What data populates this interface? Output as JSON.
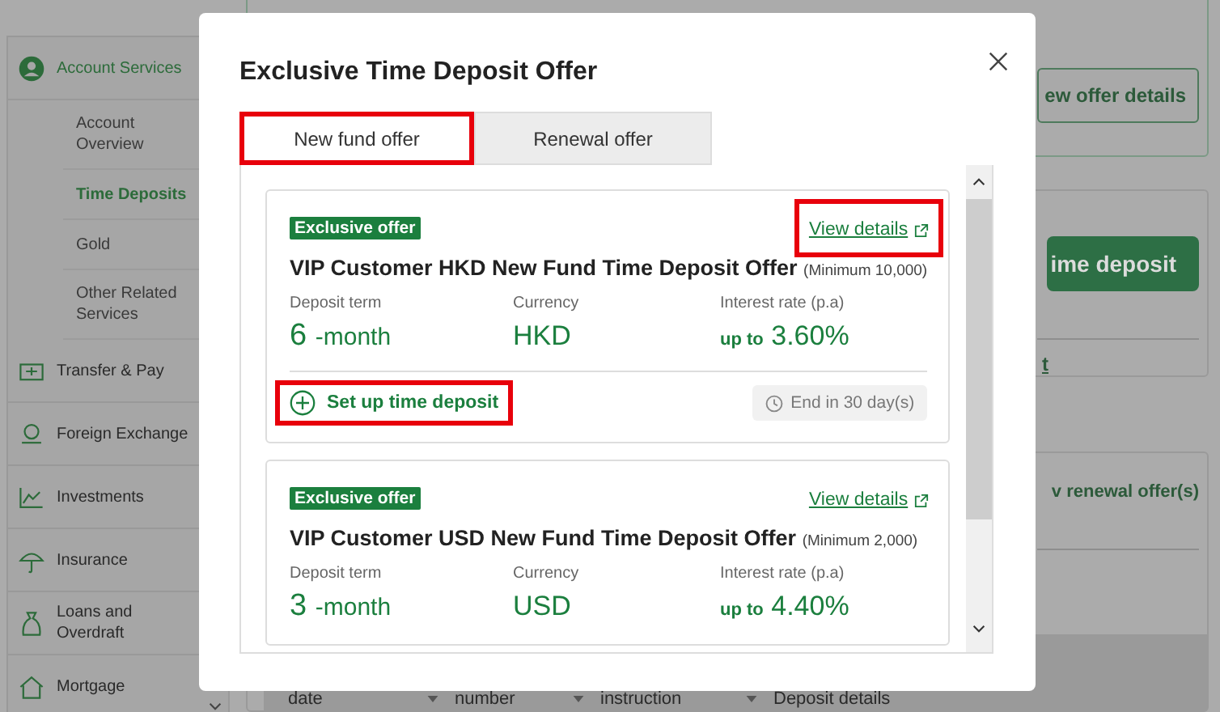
{
  "sidebar": {
    "items": [
      {
        "label": "Account Services",
        "selected": true,
        "children": [
          {
            "label": "Account Overview",
            "selected": false
          },
          {
            "label": "Time Deposits",
            "selected": true
          },
          {
            "label": "Gold",
            "selected": false
          },
          {
            "label": "Other Related Services",
            "selected": false
          }
        ]
      },
      {
        "label": "Transfer & Pay",
        "selected": false
      },
      {
        "label": "Foreign Exchange",
        "selected": false
      },
      {
        "label": "Investments",
        "selected": false
      },
      {
        "label": "Insurance",
        "selected": false
      },
      {
        "label": "Loans and Overdraft",
        "selected": false
      },
      {
        "label": "Mortgage",
        "selected": false
      }
    ]
  },
  "background": {
    "offer_button": "ew offer details",
    "setup_button": "ime deposit",
    "link": "t",
    "renewal_link": "v renewal offer(s)",
    "table_columns": [
      "date",
      "number",
      "instruction",
      "Deposit details"
    ]
  },
  "modal": {
    "title": "Exclusive Time Deposit Offer",
    "tabs": [
      {
        "label": "New fund offer",
        "selected": true,
        "highlighted": true
      },
      {
        "label": "Renewal offer",
        "selected": false,
        "highlighted": false
      }
    ],
    "offers": [
      {
        "badge": "Exclusive offer",
        "link": "View details",
        "link_highlighted": true,
        "title": "VIP Customer HKD New Fund Time Deposit Offer",
        "minimum": "(Minimum 10,000)",
        "term_label": "Deposit term",
        "term_value": "6",
        "term_unit": "-month",
        "currency_label": "Currency",
        "currency": "HKD",
        "rate_label": "Interest rate (p.a)",
        "rate_prefix": "up to",
        "rate": "3.60%",
        "action": "Set up time deposit",
        "action_highlighted": true,
        "expiry": "End in 30 day(s)"
      },
      {
        "badge": "Exclusive offer",
        "link": "View details",
        "link_highlighted": false,
        "title": "VIP Customer USD New Fund Time Deposit Offer",
        "minimum": "(Minimum  2,000)",
        "term_label": "Deposit term",
        "term_value": "3",
        "term_unit": "-month",
        "currency_label": "Currency",
        "currency": "USD",
        "rate_label": "Interest rate (p.a)",
        "rate_prefix": "up to",
        "rate": "4.40%"
      }
    ]
  }
}
